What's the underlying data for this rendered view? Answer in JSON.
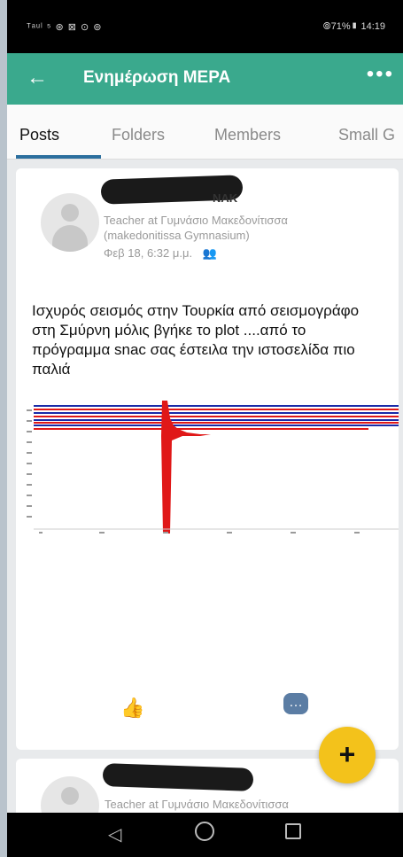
{
  "status_bar": {
    "left": "ᵀᵃᵘˡ ⁵ ⊛ ⊠ ⊙ ⊚",
    "right": "⦾71%▮ 14:19"
  },
  "app_bar": {
    "back": "←",
    "title": "Ενημέρωση ΜΕΡΑ",
    "more": "•••"
  },
  "tabs": [
    {
      "label": "Posts"
    },
    {
      "label": "Folders"
    },
    {
      "label": "Members"
    },
    {
      "label": "Small G"
    }
  ],
  "post": {
    "author_tail": "NAK",
    "role_line1": "Teacher at Γυμνάσιο Μακεδονίτισσα",
    "role_line2": "(makedonitissa Gymnasium)",
    "timestamp": "Φεβ 18, 6:32 μ.μ.",
    "text": "Ισχυρός σεισμός στην Τουρκία από σεισμογράφο στη Σμύρνη μόλις βγήκε το plot ....από το πρόγραμμα snac σας έστειλα την ιστοσελίδα πιο παλιά",
    "colors": {
      "trace_red": "#e01818",
      "trace_blue": "#1a2aa8"
    }
  },
  "post2": {
    "role": "Teacher at Γυμνάσιο Μακεδονίτισσα"
  },
  "fab": {
    "label": "+"
  },
  "nav": {
    "back": "◁"
  }
}
